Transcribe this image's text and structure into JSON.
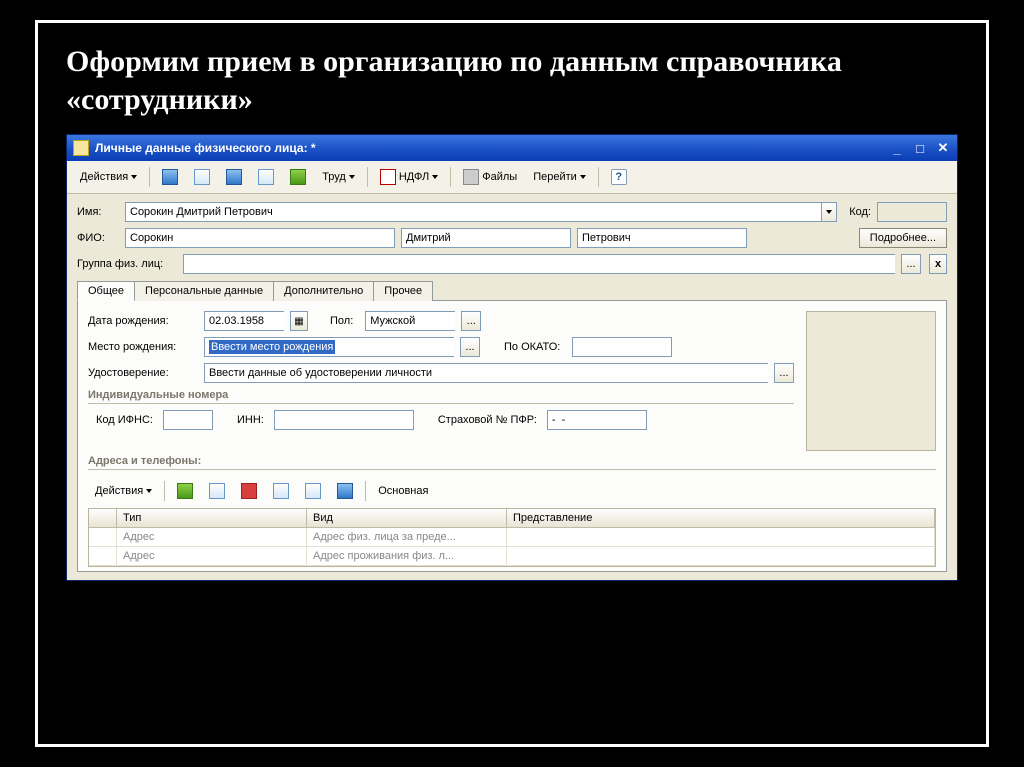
{
  "slide": {
    "title": "Оформим прием в организацию по данным справочника «сотрудники»"
  },
  "window": {
    "title": "Личные данные физического лица:  *",
    "toolbar": {
      "actions": "Действия",
      "trud": "Труд",
      "ndfl": "НДФЛ",
      "files": "Файлы",
      "goto": "Перейти",
      "help": "?"
    },
    "form": {
      "name_lbl": "Имя:",
      "name_val": "Сорокин Дмитрий Петрович",
      "code_lbl": "Код:",
      "code_val": "",
      "fio_lbl": "ФИО:",
      "surname": "Сорокин",
      "first": "Дмитрий",
      "patronymic": "Петрович",
      "more_btn": "Подробнее...",
      "group_lbl": "Группа физ. лиц:",
      "group_val": "",
      "ellipsis": "...",
      "x_btn": "x"
    },
    "tabs": {
      "t1": "Общее",
      "t2": "Персональные данные",
      "t3": "Дополнительно",
      "t4": "Прочее"
    },
    "general": {
      "dob_lbl": "Дата рождения:",
      "dob_val": "02.03.1958",
      "sex_lbl": "Пол:",
      "sex_val": "Мужской",
      "pob_lbl": "Место рождения:",
      "pob_val": "Ввести место рождения",
      "okato_lbl": "По ОКАТО:",
      "okato_val": "",
      "id_lbl": "Удостоверение:",
      "id_val": "Ввести данные об удостоверении личности",
      "numbers_hdr": "Индивидуальные номера",
      "ifns_lbl": "Код ИФНС:",
      "ifns_val": "",
      "inn_lbl": "ИНН:",
      "inn_val": "",
      "pfr_lbl": "Страховой № ПФР:",
      "pfr_val": "-  -",
      "addr_hdr": "Адреса и телефоны:",
      "sub_actions": "Действия",
      "sub_main": "Основная"
    },
    "grid": {
      "col1": "Тип",
      "col2": "Вид",
      "col3": "Представление",
      "r1c1": "Адрес",
      "r1c2": "Адрес физ. лица за преде...",
      "r2c1": "Адрес",
      "r2c2": "Адрес проживания физ. л..."
    }
  }
}
